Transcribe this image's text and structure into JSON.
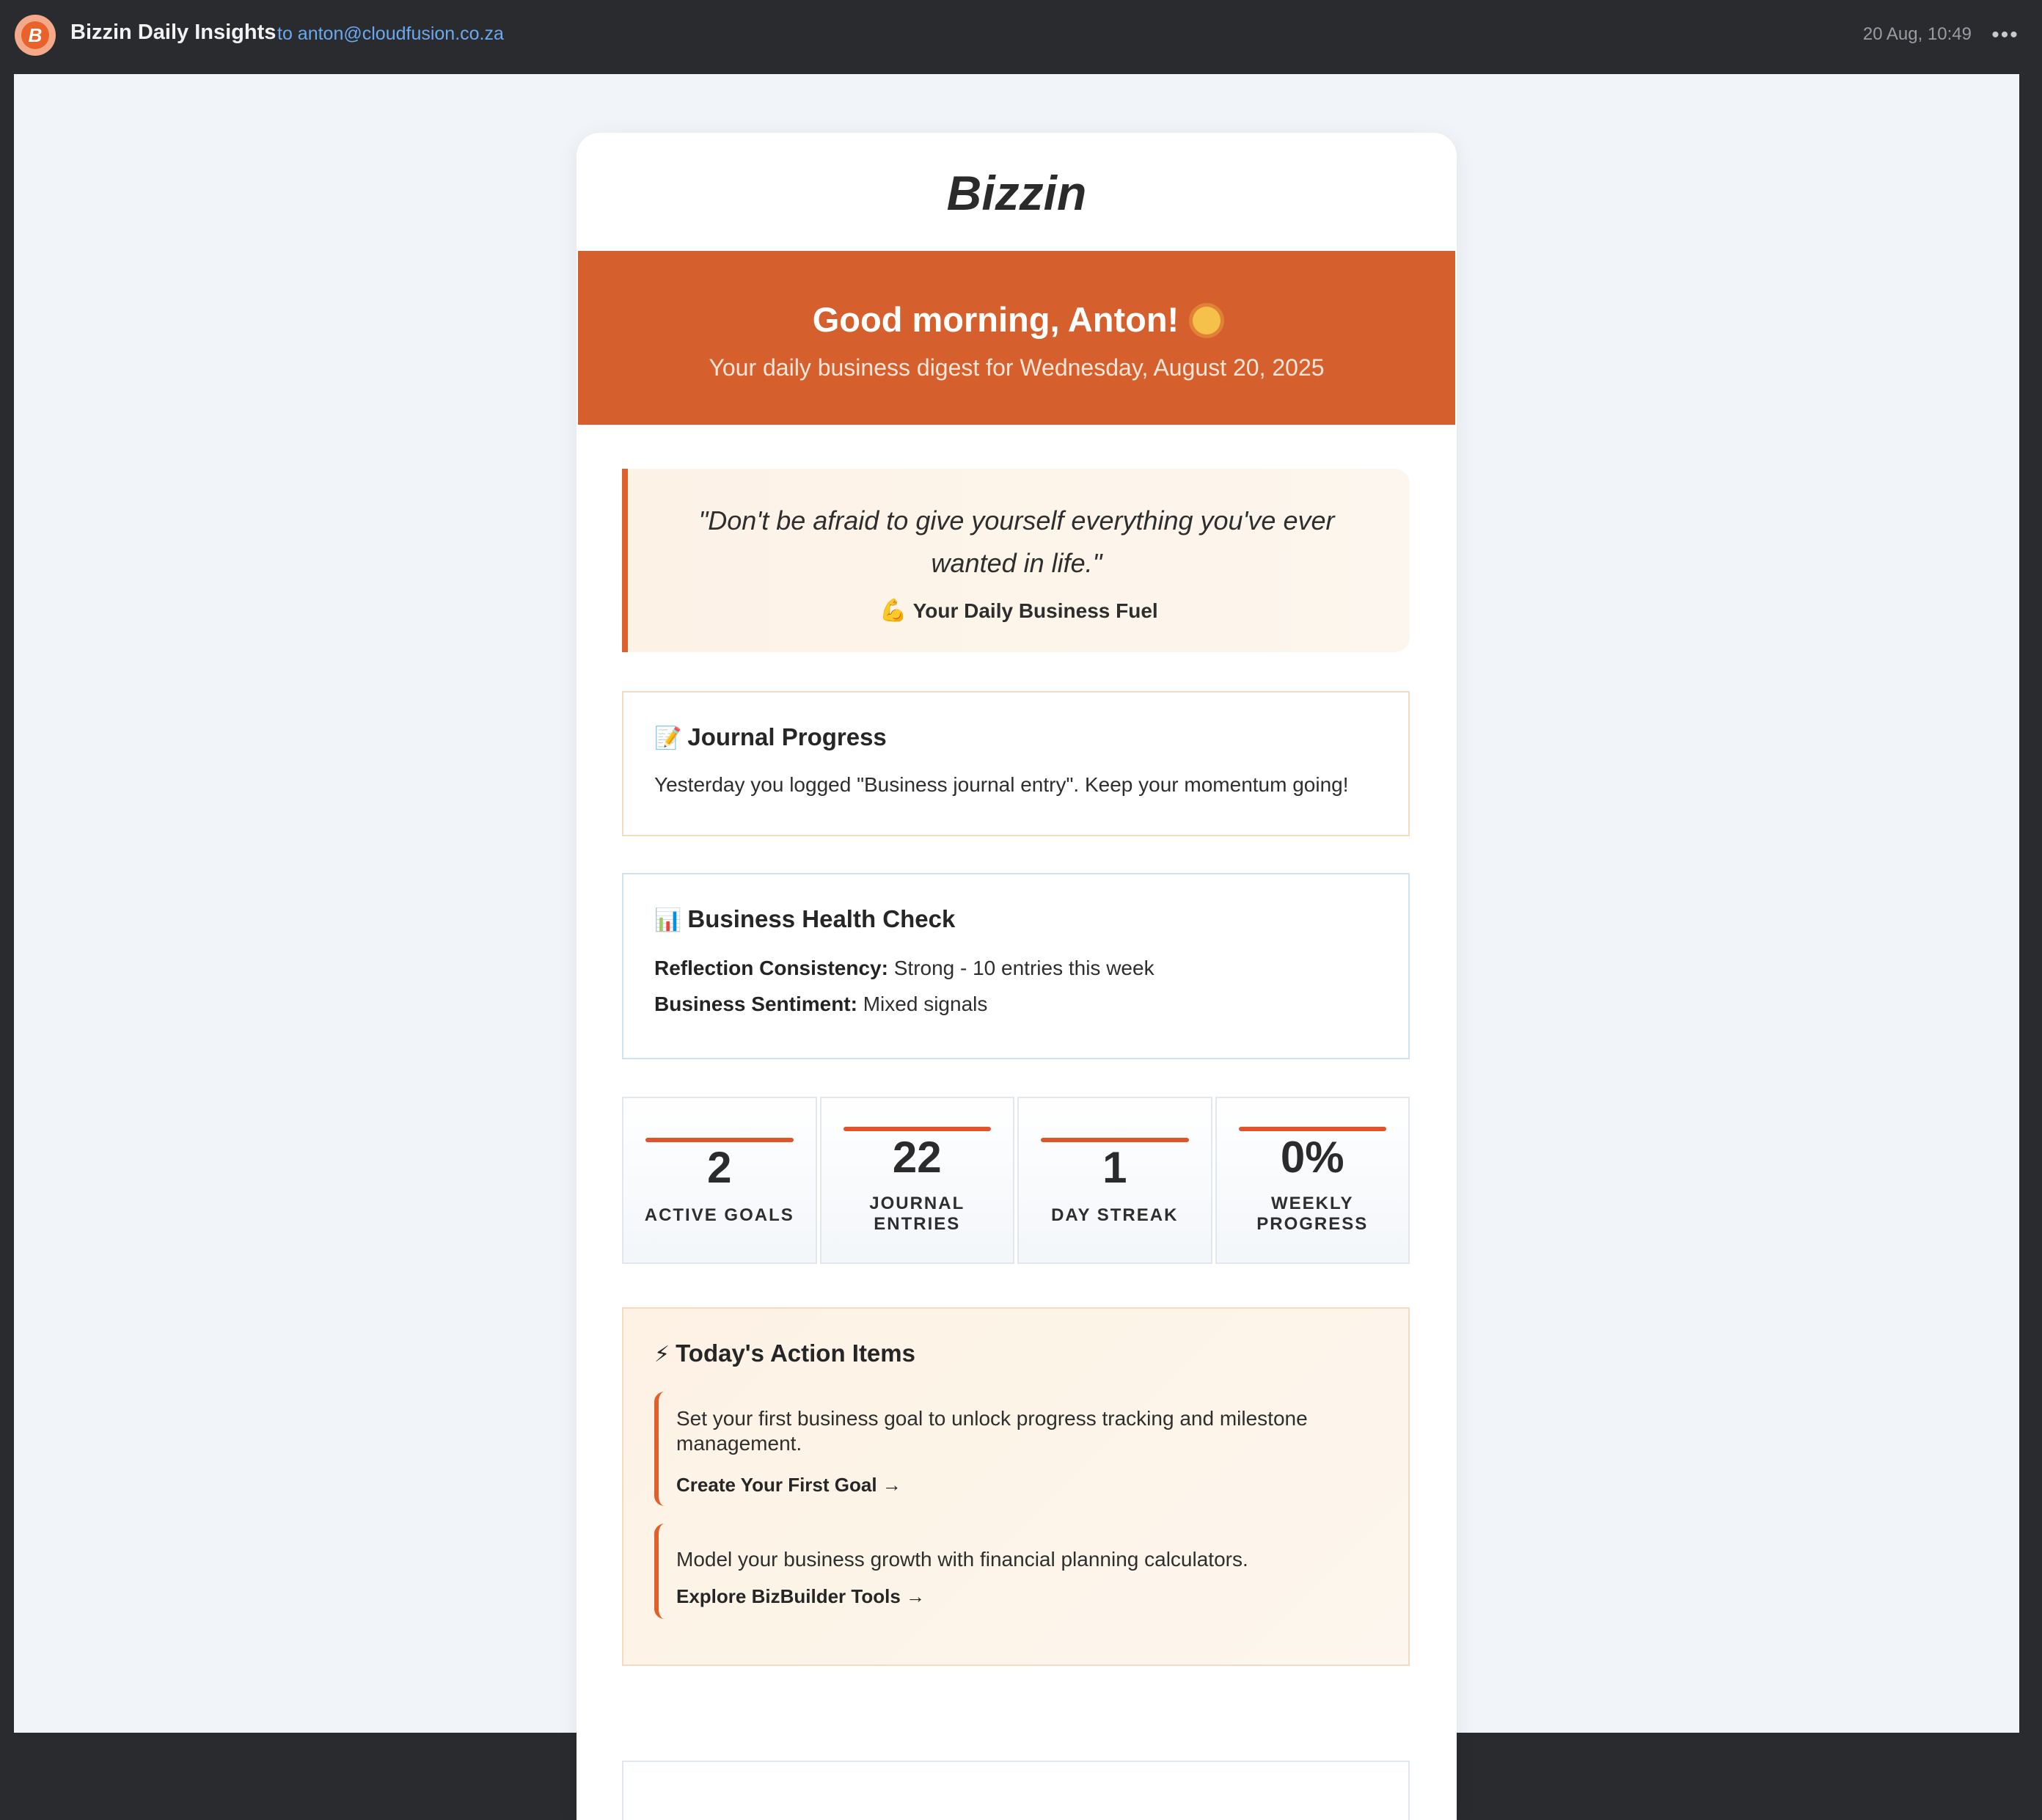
{
  "mail": {
    "sender": "Bizzin Daily Insights",
    "recipient": "to anton@cloudfusion.co.za",
    "timestamp": "20 Aug, 10:49",
    "more_icon": "more-options-icon"
  },
  "email": {
    "brand": "Bizzin",
    "greeting": "Good morning, Anton!",
    "greeting_icon": "sun-icon",
    "subtitle": "Your daily business digest for Wednesday, August 20, 2025",
    "quote": "\"Don't be afraid to give yourself everything you've ever wanted in life.\"",
    "quote_tag": "Your Daily Business Fuel",
    "quote_tag_icon": "flexed-biceps-icon",
    "journal": {
      "title": "Journal Progress",
      "icon": "memo-icon",
      "body": "Yesterday you logged \"Business journal entry\". Keep your momentum going!"
    },
    "health": {
      "title": "Business Health Check",
      "icon": "bar-chart-icon",
      "rows": [
        {
          "label": "Reflection Consistency:",
          "value": "Strong - 10 entries this week"
        },
        {
          "label": "Business Sentiment:",
          "value": "Mixed signals"
        }
      ]
    },
    "stats": [
      {
        "value": "2",
        "label": "ACTIVE GOALS"
      },
      {
        "value": "22",
        "label": "JOURNAL ENTRIES"
      },
      {
        "value": "1",
        "label": "DAY STREAK"
      },
      {
        "value": "0%",
        "label": "WEEKLY PROGRESS"
      }
    ],
    "actions": {
      "title": "Today's Action Items",
      "icon": "lightning-icon",
      "items": [
        {
          "text": "Set your first business goal to unlock progress tracking and milestone management.",
          "link": "Create Your First Goal →"
        },
        {
          "text": "Model your business growth with financial planning calculators.",
          "link": "Explore BizBuilder Tools →"
        }
      ]
    },
    "colors": {
      "accent": "#d5602d",
      "accent_bar": "#e0542c",
      "link": "#6aa9f0"
    }
  }
}
